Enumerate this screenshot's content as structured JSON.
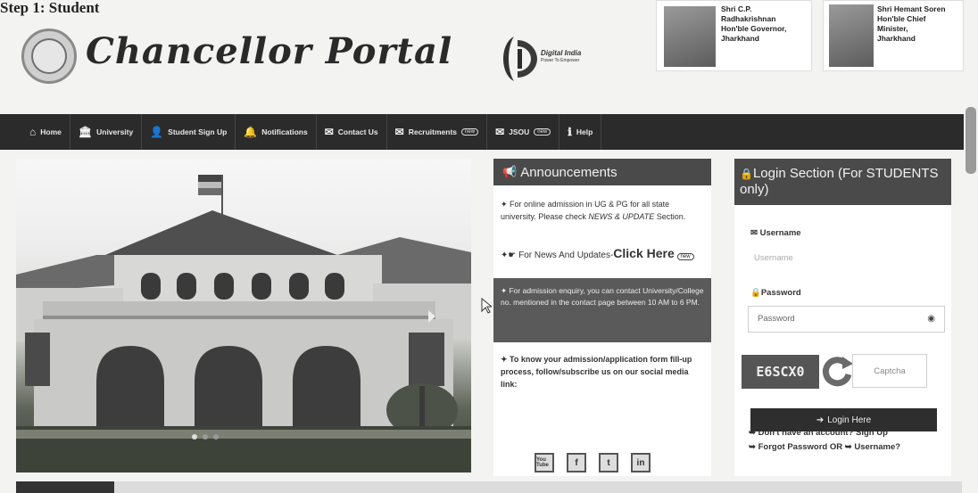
{
  "step_heading": "Step 1: Student",
  "site": {
    "title": "Chancellor Portal"
  },
  "digital_india": {
    "name": "Digital India",
    "tagline": "Power To Empower"
  },
  "people": [
    {
      "lines": [
        "Shri C.P.",
        "Radhakrishnan",
        "Hon'ble Governor,",
        "Jharkhand"
      ]
    },
    {
      "lines": [
        "Shri Hemant Soren",
        "Hon'ble Chief",
        "Minister,",
        "Jharkhand"
      ]
    }
  ],
  "nav": [
    {
      "label": "Home",
      "icon": "home-icon",
      "glyph": "⌂"
    },
    {
      "label": "University",
      "icon": "university-icon",
      "glyph": "🏛"
    },
    {
      "label": "Student Sign Up",
      "icon": "student-icon",
      "glyph": "👤"
    },
    {
      "label": "Notifications",
      "icon": "bell-icon",
      "glyph": "🔔"
    },
    {
      "label": "Contact Us",
      "icon": "envelope-icon",
      "glyph": "✉"
    },
    {
      "label": "Recruitments",
      "icon": "envelope-icon",
      "glyph": "✉",
      "badge": "new"
    },
    {
      "label": "JSOU",
      "icon": "envelope-icon",
      "glyph": "✉",
      "badge": "new"
    },
    {
      "label": "Help",
      "icon": "info-icon",
      "glyph": "ℹ"
    }
  ],
  "announcements": {
    "title": "Announcements",
    "item1_pre": "✦ For online admission in UG & PG for all state university. Please check ",
    "item1_em": "NEWS & UPDATE",
    "item1_post": " Section.",
    "news_pre": "✦☛ For News And Updates-",
    "news_click": "Click Here",
    "news_badge": "new",
    "enquiry": "✦ For admission enquiry, you can contact University/College no. mentioned in the contact page between 10 AM to 6 PM.",
    "process": "✦ To know your admission/application form fill-up process, follow/subscribe us on our social media link:",
    "social": [
      "You Tube",
      "f",
      "t",
      "in"
    ]
  },
  "login": {
    "title": "Login Section (For STUDENTS only)",
    "username_label": "Username",
    "username_placeholder": "Username",
    "password_label": "Password",
    "password_placeholder": "Password",
    "captcha_code": "E6SCX0",
    "captcha_placeholder": "Captcha",
    "button": "Login Here",
    "signup_text": "Don't have an account? Sign Up",
    "forgot_text": "Forgot Password OR ➥ Username?"
  }
}
